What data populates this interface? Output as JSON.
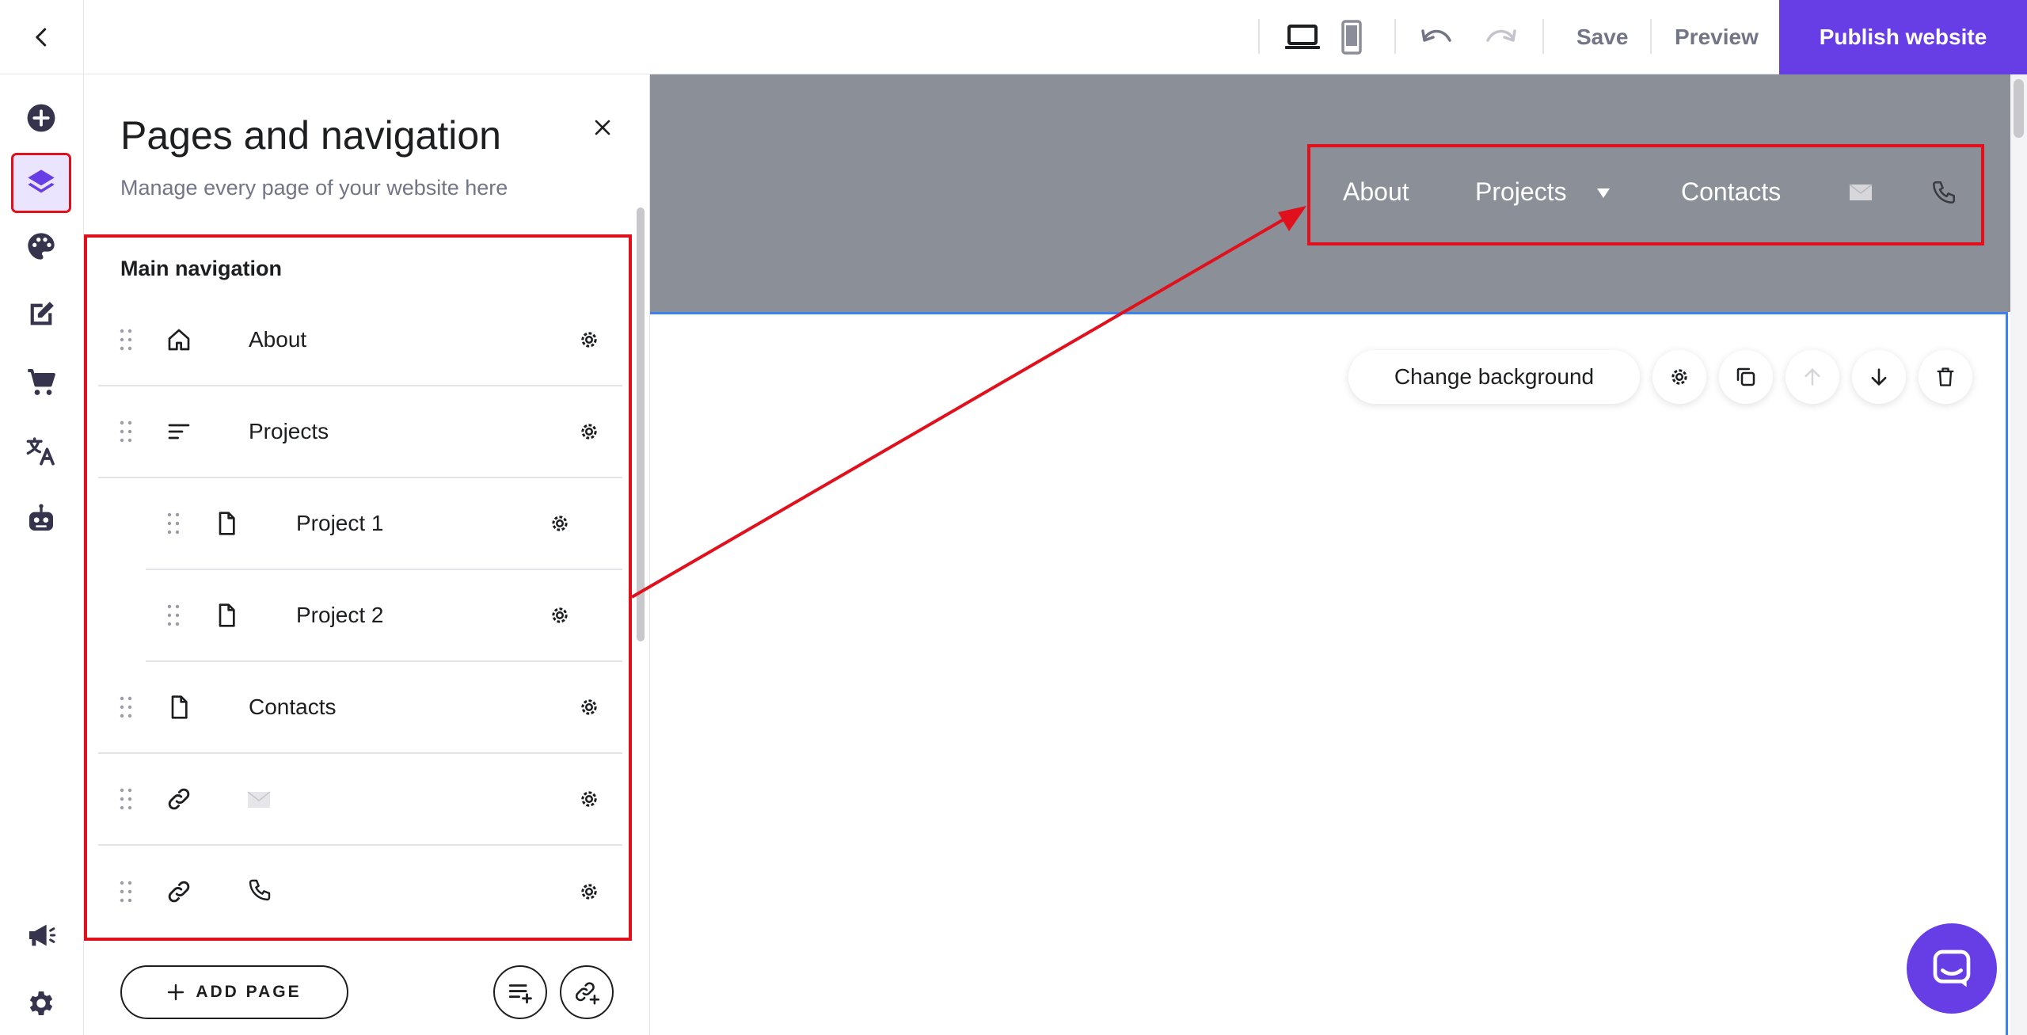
{
  "topbar": {
    "back_icon": "chevron-left-icon",
    "device_desktop_icon": "laptop-icon",
    "device_mobile_icon": "mobile-icon",
    "undo_icon": "undo-icon",
    "redo_icon": "redo-icon",
    "save_label": "Save",
    "preview_label": "Preview",
    "publish_label": "Publish website",
    "accent": "#673de6"
  },
  "rail": {
    "items": [
      {
        "icon": "add-circle-icon"
      },
      {
        "icon": "layers-icon",
        "active": true
      },
      {
        "icon": "palette-icon"
      },
      {
        "icon": "edit-icon"
      },
      {
        "icon": "cart-icon"
      },
      {
        "icon": "translate-icon"
      },
      {
        "icon": "robot-icon"
      },
      {
        "icon": "megaphone-icon"
      },
      {
        "icon": "gear-icon"
      }
    ]
  },
  "panel": {
    "title": "Pages and navigation",
    "subtitle": "Manage every page of your website here",
    "close_icon": "close-icon",
    "section_heading": "Main navigation",
    "items": [
      {
        "type_icon": "home-icon",
        "label": "About",
        "level": 0
      },
      {
        "type_icon": "folder-list-icon",
        "label": "Projects",
        "level": 0
      },
      {
        "type_icon": "page-icon",
        "label": "Project 1",
        "level": 1
      },
      {
        "type_icon": "page-icon",
        "label": "Project 2",
        "level": 1
      },
      {
        "type_icon": "page-icon",
        "label": "Contacts",
        "level": 0
      },
      {
        "type_icon": "link-icon",
        "label_icon": "envelope-icon",
        "level": 0
      },
      {
        "type_icon": "link-icon",
        "label_icon": "phone-icon",
        "level": 0
      }
    ],
    "add_page_label": "ADD PAGE",
    "add_dropdown_icon": "add-dropdown-icon",
    "add_link_icon": "add-link-icon"
  },
  "canvas": {
    "site_nav": {
      "items": [
        "About",
        "Projects",
        "Contacts"
      ],
      "dropdown_icon": "triangle-down-icon",
      "mail_icon": "envelope-icon",
      "phone_icon": "phone-icon"
    },
    "section_toolbar": {
      "change_background_label": "Change background",
      "settings_icon": "gear-icon",
      "duplicate_icon": "duplicate-icon",
      "move_up_icon": "arrow-up-icon",
      "move_down_icon": "arrow-down-icon",
      "delete_icon": "trash-icon"
    },
    "hero_color": "#8b9098",
    "highlight_color": "#e0101c"
  },
  "chat": {
    "icon": "chat-icon"
  }
}
